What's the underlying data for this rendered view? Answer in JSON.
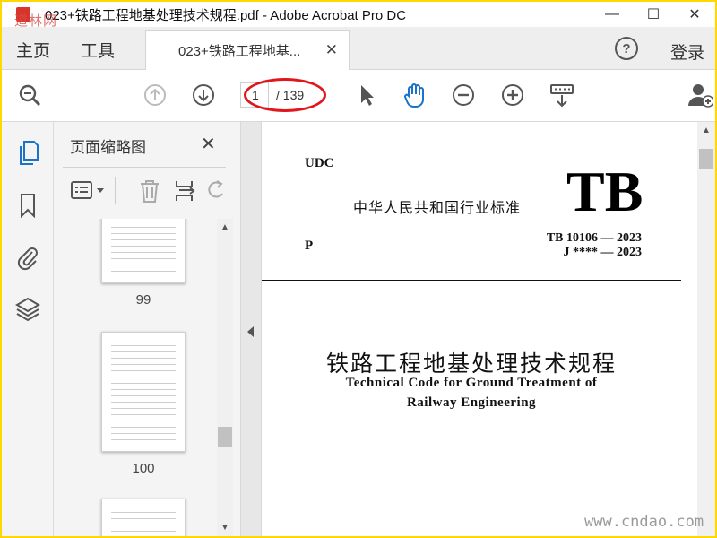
{
  "window": {
    "title": "023+铁路工程地基处理技术规程.pdf - Adobe Acrobat Pro DC",
    "watermark_top": "道林网",
    "minimize_glyph": "—",
    "maximize_glyph": "☐",
    "close_glyph": "✕"
  },
  "menubar": {
    "home": "主页",
    "tools": "工具",
    "tab_label": "023+铁路工程地基...",
    "tab_close": "✕",
    "help_glyph": "?",
    "login": "登录"
  },
  "toolbar": {
    "current_page": "1",
    "total_pages": "/ 139",
    "icons": [
      "magnifier-icon",
      "page-up-icon",
      "page-down-icon",
      "select-arrow-icon",
      "hand-icon",
      "zoom-out-icon",
      "zoom-in-icon",
      "scroll-mode-icon",
      "add-user-icon"
    ],
    "annotation_color": "#e0161c"
  },
  "thumbnail_panel": {
    "title": "页面缩略图",
    "close": "✕",
    "thumbs": [
      {
        "page": "99"
      },
      {
        "page": "100"
      }
    ]
  },
  "document": {
    "udc": "UDC",
    "standard_name": "中华人民共和国行业标准",
    "tb": "TB",
    "p": "P",
    "code1": "TB  10106 — 2023",
    "code2": "J **** — 2023",
    "cn_title": "铁路工程地基处理技术规程",
    "en_title_line1": "Technical Code for Ground Treatment of",
    "en_title_line2": "Railway Engineering"
  },
  "watermark_bottom": "www.cndao.com",
  "colors": {
    "frame_border": "#ffd800",
    "accent_blue": "#1a73c9"
  }
}
